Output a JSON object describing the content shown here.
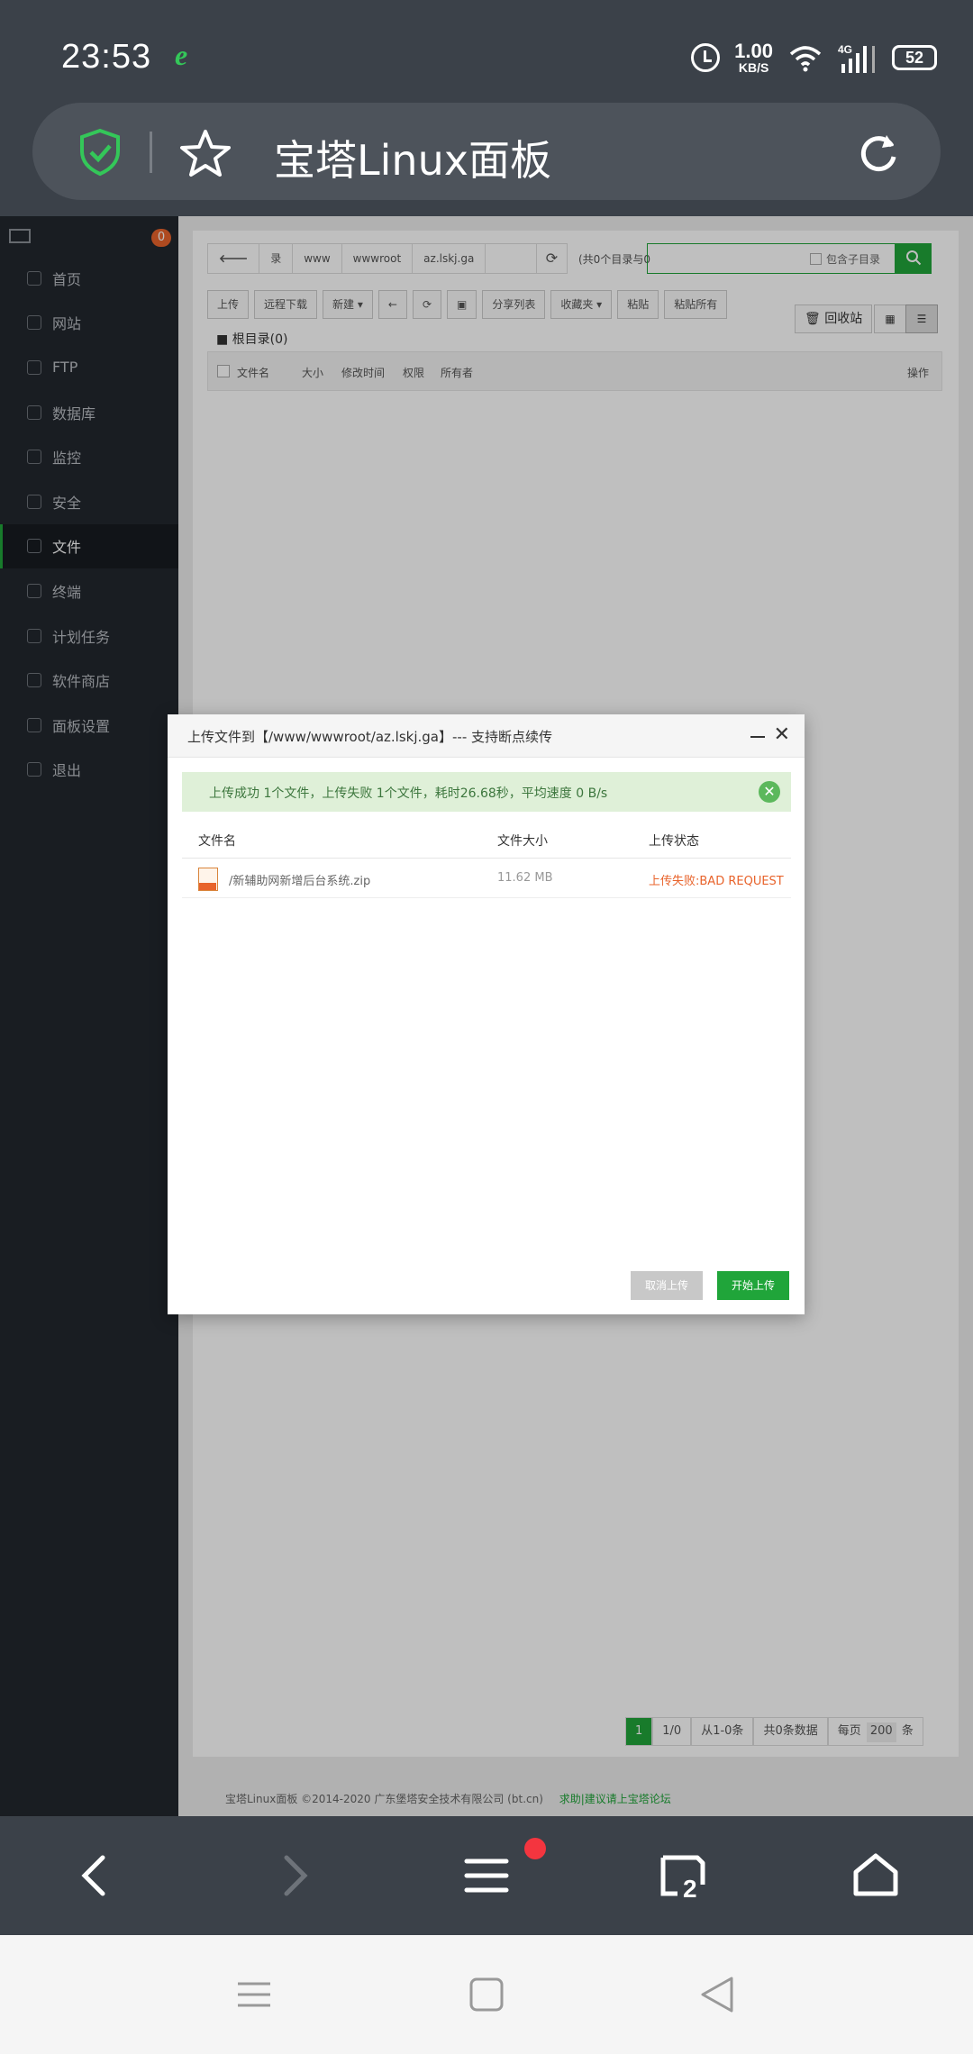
{
  "status_bar": {
    "time": "23:53",
    "net_speed_value": "1.00",
    "net_speed_unit": "KB/S",
    "battery": "52",
    "network": "4G"
  },
  "address_bar": {
    "title": "宝塔Linux面板"
  },
  "sidebar": {
    "badge": "0",
    "items": [
      {
        "label": "首页",
        "icon": "home-icon"
      },
      {
        "label": "网站",
        "icon": "globe-icon"
      },
      {
        "label": "FTP",
        "icon": "ftp-icon"
      },
      {
        "label": "数据库",
        "icon": "database-icon"
      },
      {
        "label": "监控",
        "icon": "monitor-icon"
      },
      {
        "label": "安全",
        "icon": "shield-icon"
      },
      {
        "label": "文件",
        "icon": "folder-icon",
        "active": true
      },
      {
        "label": "终端",
        "icon": "terminal-icon"
      },
      {
        "label": "计划任务",
        "icon": "clock-icon"
      },
      {
        "label": "软件商店",
        "icon": "apps-icon"
      },
      {
        "label": "面板设置",
        "icon": "gear-icon"
      },
      {
        "label": "退出",
        "icon": "logout-icon"
      }
    ]
  },
  "file_manager": {
    "crumbs": [
      "录",
      "www",
      "wwwroot",
      "az.lskj.ga"
    ],
    "path_info": "(共0个目录与0",
    "search_checkbox_label": "包含子目录",
    "toolbar": [
      "上传",
      "远程下载",
      "新建 ▾",
      "←",
      "⟳",
      "▣",
      "分享列表",
      "收藏夹 ▾",
      "粘贴",
      "粘贴所有"
    ],
    "recycle_label": "回收站",
    "root_dir": "根目录(0)",
    "columns": [
      "文件名",
      "大小",
      "修改时间",
      "权限",
      "所有者",
      "操作"
    ],
    "pager": {
      "current": "1",
      "pages": "1/0",
      "range": "从1-0条",
      "total": "共0条数据",
      "per_page_label": "每页",
      "per_page_value": "200",
      "unit": "条"
    },
    "footer": {
      "copyright": "宝塔Linux面板 ©2014-2020 广东堡塔安全技术有限公司 (bt.cn)",
      "link": "求助|建议请上宝塔论坛"
    }
  },
  "upload_dialog": {
    "title": "上传文件到【/www/wwwroot/az.lskj.ga】--- 支持断点续传",
    "alert": "上传成功 1个文件，上传失败 1个文件，耗时26.68秒，平均速度 0 B/s",
    "columns": [
      "文件名",
      "文件大小",
      "上传状态"
    ],
    "files": [
      {
        "name": "/新辅助网新增后台系统.zip",
        "size": "11.62 MB",
        "status": "上传失败:BAD REQUEST"
      }
    ],
    "cancel_label": "取消上传",
    "start_label": "开始上传"
  },
  "bottom_bar": {
    "tabs_count": "2"
  },
  "colors": {
    "brand_green": "#20a53a",
    "error_red": "#e8632b",
    "badge_red": "#f4353f"
  }
}
